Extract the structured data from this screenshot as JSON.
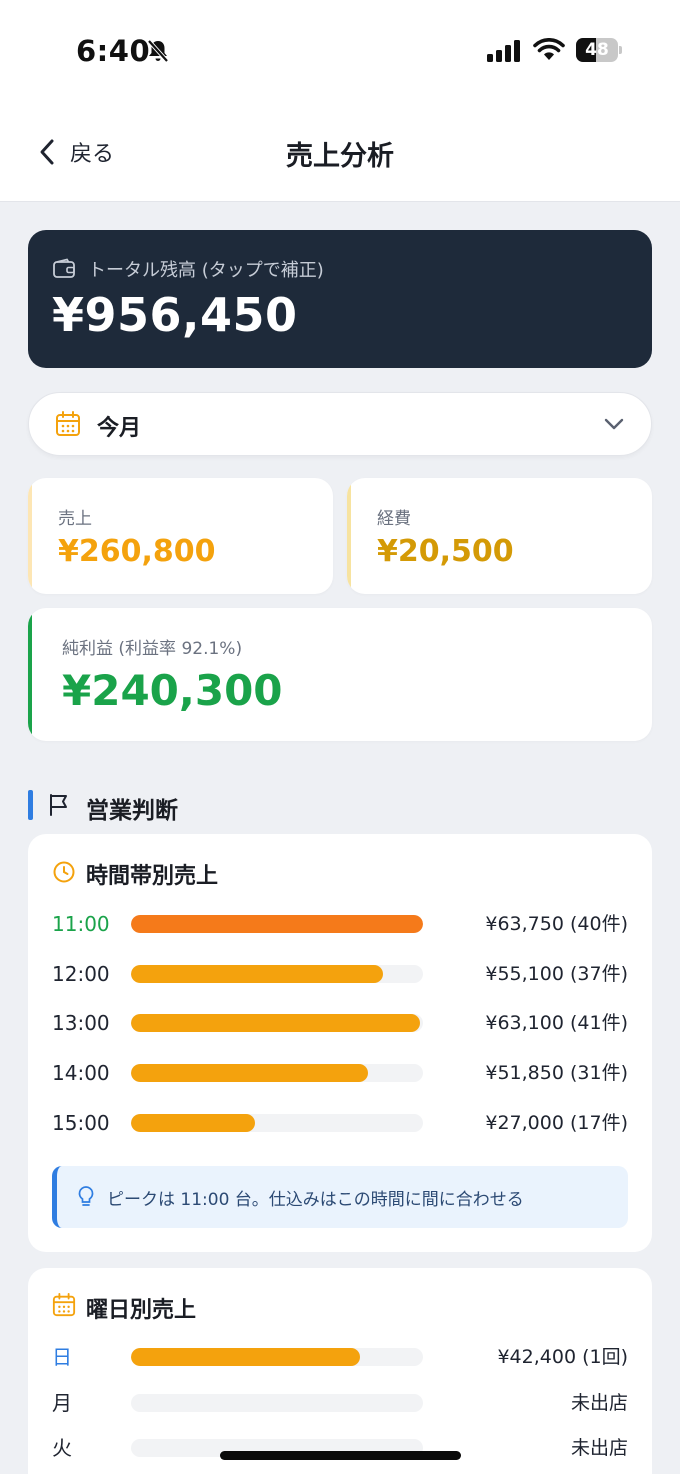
{
  "status_bar": {
    "time": "6:40",
    "battery": "48",
    "battery_level": 0.48
  },
  "nav": {
    "back_label": "戻る",
    "title": "売上分析"
  },
  "balance": {
    "label": "トータル残高 (タップで補正)",
    "value": "¥956,450"
  },
  "period": {
    "selected": "今月"
  },
  "stats": {
    "sales": {
      "label": "売上",
      "value": "¥260,800"
    },
    "expenses": {
      "label": "経費",
      "value": "¥20,500"
    },
    "profit": {
      "label": "純利益 (利益率 92.1%)",
      "value": "¥240,300"
    }
  },
  "section": {
    "title": "営業判断"
  },
  "hourly": {
    "title": "時間帯別売上",
    "rows": [
      {
        "label": "11:00",
        "value": "¥63,750 (40件)",
        "fraction": 1.0,
        "peak": true
      },
      {
        "label": "12:00",
        "value": "¥55,100 (37件)",
        "fraction": 0.864,
        "peak": false
      },
      {
        "label": "13:00",
        "value": "¥63,100 (41件)",
        "fraction": 0.99,
        "peak": false
      },
      {
        "label": "14:00",
        "value": "¥51,850 (31件)",
        "fraction": 0.813,
        "peak": false
      },
      {
        "label": "15:00",
        "value": "¥27,000 (17件)",
        "fraction": 0.424,
        "peak": false
      }
    ],
    "tip": "ピークは 11:00 台。仕込みはこの時間に間に合わせる"
  },
  "weekday": {
    "title": "曜日別売上",
    "rows": [
      {
        "label": "日",
        "value": "¥42,400 (1回)",
        "fraction": 0.785
      },
      {
        "label": "月",
        "value": "未出店",
        "fraction": 0
      },
      {
        "label": "火",
        "value": "未出店",
        "fraction": 0
      }
    ]
  },
  "colors": {
    "sales_accent": "#f4a20d",
    "expense_accent": "#d49a06",
    "profit_accent": "#1aa34a",
    "peak_bar": "#f57a1a",
    "bar": "#f4a20d",
    "sunday_label": "#2f7de1",
    "peak_label": "#1aa34a",
    "balance_card": "#1e2a3a"
  }
}
